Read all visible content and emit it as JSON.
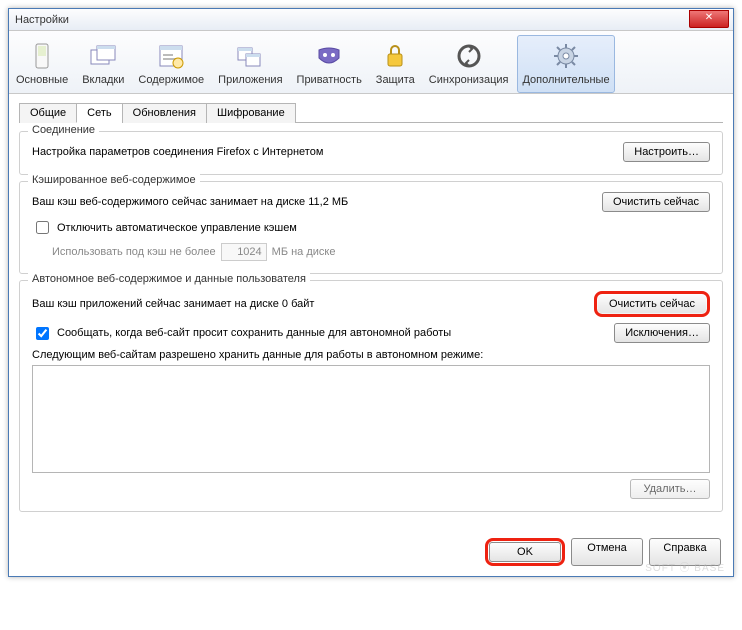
{
  "title": "Настройки",
  "toolbar": [
    {
      "label": "Основные"
    },
    {
      "label": "Вкладки"
    },
    {
      "label": "Содержимое"
    },
    {
      "label": "Приложения"
    },
    {
      "label": "Приватность"
    },
    {
      "label": "Защита"
    },
    {
      "label": "Синхронизация"
    },
    {
      "label": "Дополнительные"
    }
  ],
  "tabs": [
    "Общие",
    "Сеть",
    "Обновления",
    "Шифрование"
  ],
  "connection": {
    "title": "Соединение",
    "text": "Настройка параметров соединения Firefox с Интернетом",
    "button": "Настроить…"
  },
  "cache": {
    "title": "Кэшированное веб-содержимое",
    "usage": "Ваш кэш веб-содержимого сейчас занимает на диске 11,2 МБ",
    "clear": "Очистить сейчас",
    "override_label": "Отключить автоматическое управление кэшем",
    "limit_prefix": "Использовать под кэш не более",
    "limit_value": "1024",
    "limit_suffix": "МБ на диске"
  },
  "offline": {
    "title": "Автономное веб-содержимое и данные пользователя",
    "usage": "Ваш кэш приложений сейчас занимает на диске 0 байт",
    "clear": "Очистить сейчас",
    "notify_label": "Сообщать, когда веб-сайт просит сохранить данные для автономной работы",
    "exceptions": "Исключения…",
    "list_label": "Следующим веб-сайтам разрешено хранить данные для работы в автономном режиме:",
    "remove": "Удалить…"
  },
  "footer": {
    "ok": "OK",
    "cancel": "Отмена",
    "help": "Справка"
  },
  "watermark": "SOFT ⦿ BASE"
}
